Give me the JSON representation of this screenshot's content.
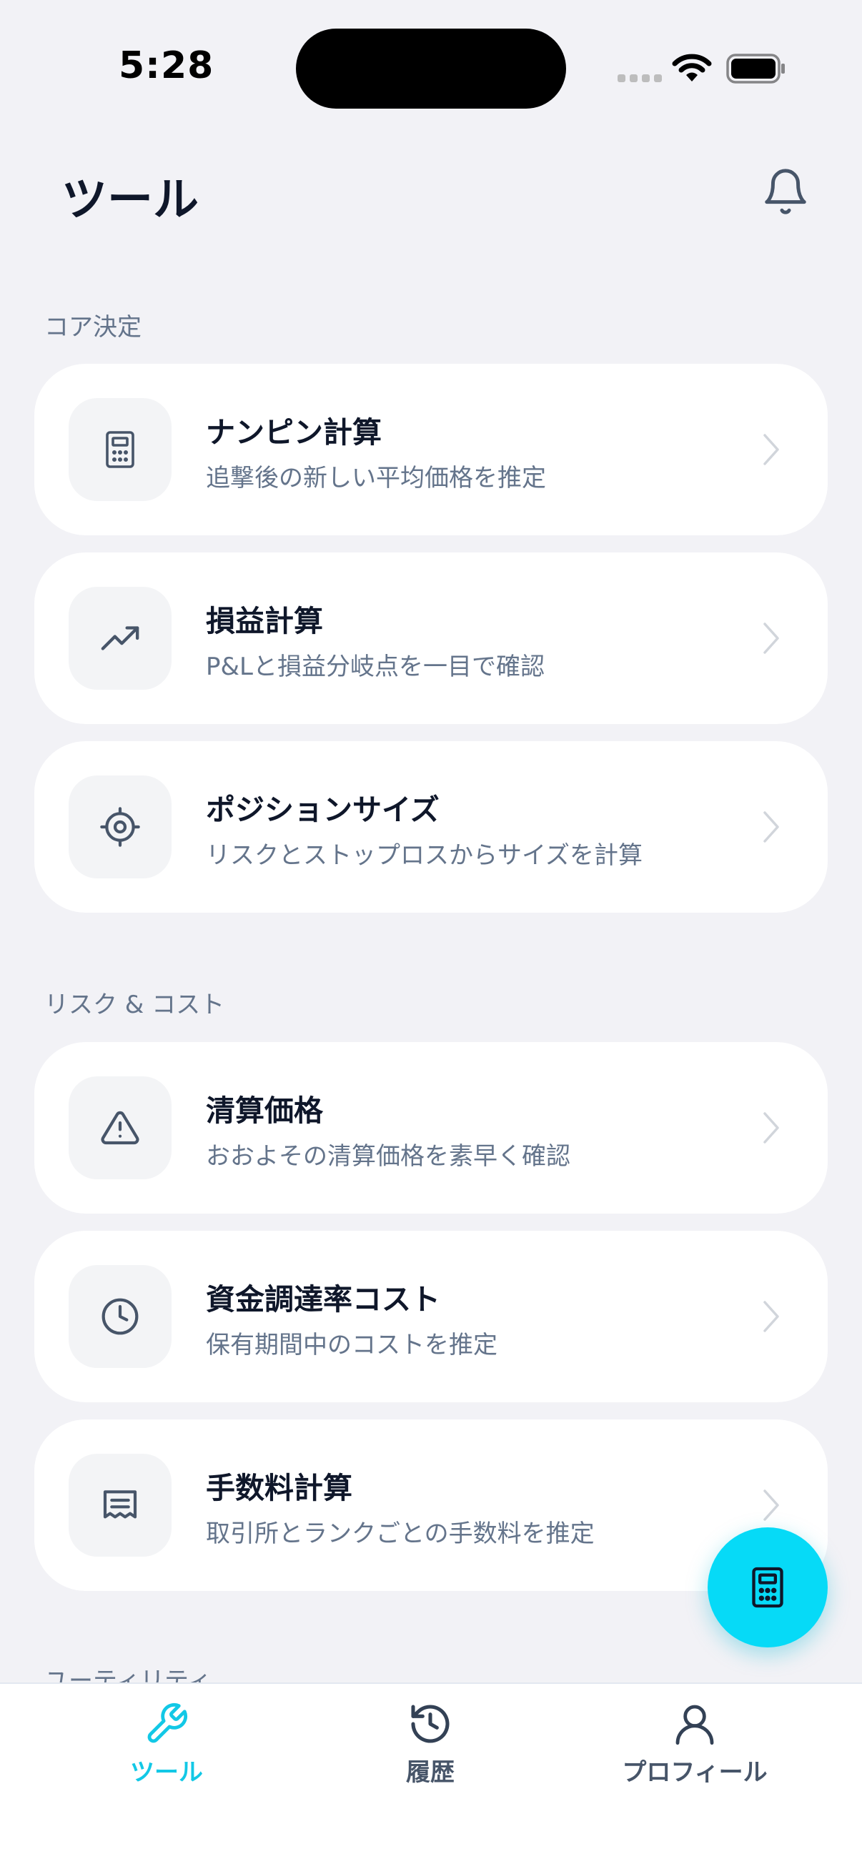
{
  "status": {
    "time": "5:28"
  },
  "header": {
    "title": "ツール"
  },
  "sections": [
    {
      "label": "コア決定",
      "items": [
        {
          "title": "ナンピン計算",
          "subtitle": "追撃後の新しい平均価格を推定",
          "icon": "calculator-icon"
        },
        {
          "title": "損益計算",
          "subtitle": "P&Lと損益分岐点を一目で確認",
          "icon": "trending-up-icon"
        },
        {
          "title": "ポジションサイズ",
          "subtitle": "リスクとストップロスからサイズを計算",
          "icon": "crosshair-icon"
        }
      ]
    },
    {
      "label": "リスク & コスト",
      "items": [
        {
          "title": "清算価格",
          "subtitle": "おおよその清算価格を素早く確認",
          "icon": "alert-triangle-icon"
        },
        {
          "title": "資金調達率コスト",
          "subtitle": "保有期間中のコストを推定",
          "icon": "clock-icon"
        },
        {
          "title": "手数料計算",
          "subtitle": "取引所とランクごとの手数料を推定",
          "icon": "receipt-icon"
        }
      ]
    },
    {
      "label": "ユーティリティ"
    }
  ],
  "tabbar": {
    "tabs": [
      {
        "label": "ツール",
        "icon": "wrench-icon",
        "active": true
      },
      {
        "label": "履歴",
        "icon": "history-icon",
        "active": false
      },
      {
        "label": "プロフィール",
        "icon": "user-icon",
        "active": false
      }
    ]
  },
  "colors": {
    "accent": "#06DAF7",
    "background": "#F2F2F6",
    "card": "#FFFFFF",
    "title_text": "#0F172A",
    "secondary_text": "#64748B"
  }
}
